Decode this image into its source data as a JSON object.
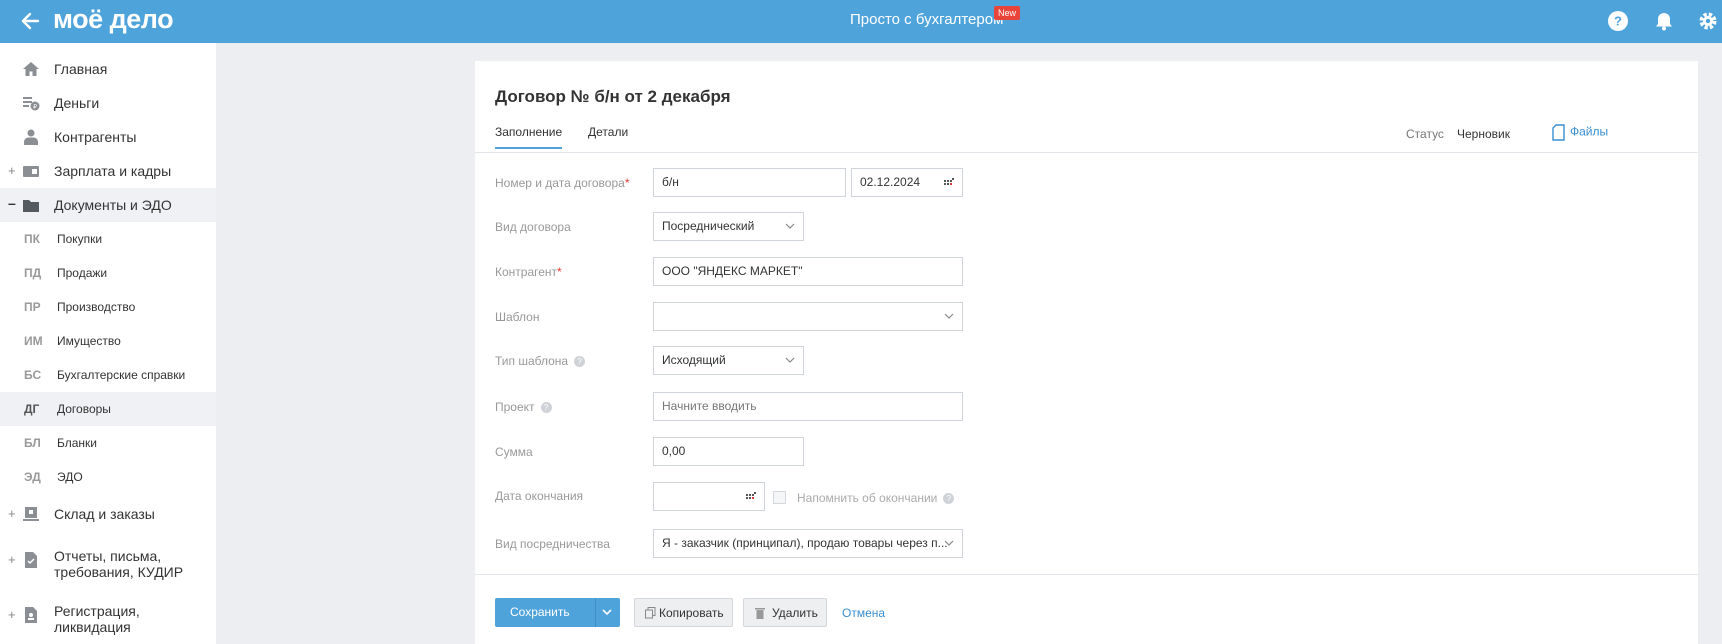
{
  "topbar": {
    "logo": "моё дело",
    "center_title": "Просто с бухгалтером",
    "new_badge": "New"
  },
  "sidebar": {
    "items": [
      {
        "label": "Главная",
        "icon": "home-icon"
      },
      {
        "label": "Деньги",
        "icon": "money-icon"
      },
      {
        "label": "Контрагенты",
        "icon": "contractors-icon"
      },
      {
        "label": "Зарплата и кадры",
        "icon": "salary-icon",
        "prefix": "+"
      },
      {
        "label": "Документы и ЭДО",
        "icon": "folder-icon",
        "prefix": "–"
      }
    ],
    "subitems": [
      {
        "abbr": "ПК",
        "label": "Покупки"
      },
      {
        "abbr": "ПД",
        "label": "Продажи"
      },
      {
        "abbr": "ПР",
        "label": "Производство"
      },
      {
        "abbr": "ИМ",
        "label": "Имущество"
      },
      {
        "abbr": "БС",
        "label": "Бухгалтерские справки"
      },
      {
        "abbr": "ДГ",
        "label": "Договоры"
      },
      {
        "abbr": "БЛ",
        "label": "Бланки"
      },
      {
        "abbr": "ЭД",
        "label": "ЭДО"
      }
    ],
    "bottom_items": [
      {
        "label": "Склад и заказы",
        "icon": "warehouse-icon",
        "prefix": "+"
      },
      {
        "label": "Отчеты, письма, требования, КУДИР",
        "icon": "reports-icon",
        "prefix": "+"
      },
      {
        "label": "Регистрация, ликвидация",
        "icon": "registration-icon",
        "prefix": "+"
      }
    ]
  },
  "document": {
    "title": "Договор № б/н от 2 декабря",
    "tabs": [
      "Заполнение",
      "Детали"
    ],
    "status_label": "Статус",
    "status_value": "Черновик",
    "files_label": "Файлы"
  },
  "form": {
    "number_date": {
      "label": "Номер и дата договора",
      "number": "б/н",
      "date": "02.12.2024"
    },
    "contract_type": {
      "label": "Вид договора",
      "value": "Посреднический"
    },
    "contractor": {
      "label": "Контрагент",
      "value": "ООО \"ЯНДЕКС МАРКЕТ\""
    },
    "template": {
      "label": "Шаблон",
      "value": ""
    },
    "template_type": {
      "label": "Тип шаблона",
      "value": "Исходящий"
    },
    "project": {
      "label": "Проект",
      "placeholder": "Начните вводить"
    },
    "amount": {
      "label": "Сумма",
      "value": "0,00"
    },
    "end_date": {
      "label": "Дата окончания",
      "value": "",
      "remind_label": "Напомнить об окончании"
    },
    "mediation_type": {
      "label": "Вид посредничества",
      "value": "Я - заказчик (принципал), продаю товары через п..."
    }
  },
  "actions": {
    "save": "Сохранить",
    "copy": "Копировать",
    "delete": "Удалить",
    "cancel": "Отмена"
  },
  "colors": {
    "accent": "#4fa3db",
    "link": "#3a8ed0",
    "required": "#e53935",
    "badge": "#e8443a"
  }
}
